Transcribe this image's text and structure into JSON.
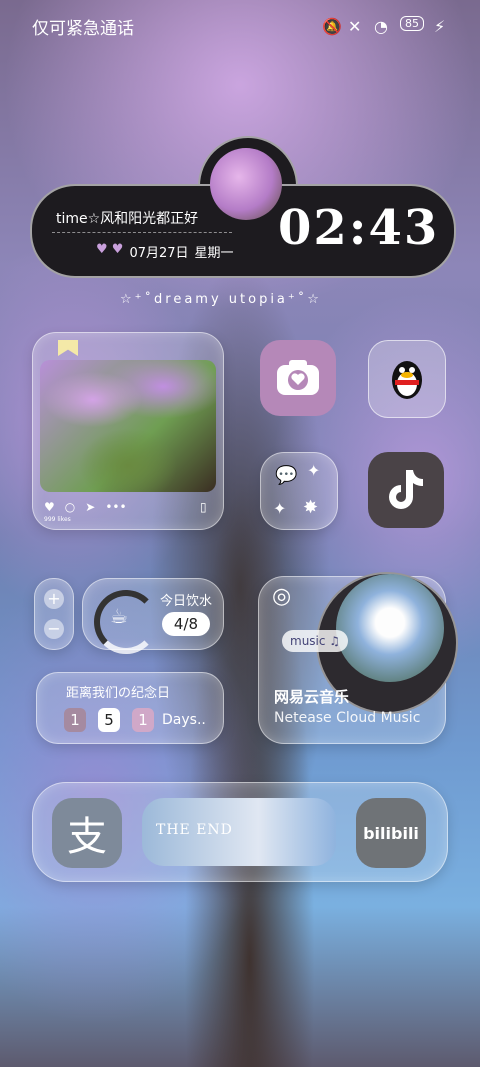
{
  "status_bar": {
    "carrier": "仅可紧急通话",
    "battery": "85"
  },
  "top_widget": {
    "motto": "time☆风和阳光都正好",
    "date": "07月27日",
    "weekday": "星期一",
    "time": "02:43"
  },
  "tagline": "☆⁺˚dreamy utopia⁺˚☆",
  "photo_widget": {
    "likes": "999 likes"
  },
  "apps": {
    "alipay": "支",
    "bilibili": "bilibili"
  },
  "water": {
    "title": "今日饮水",
    "value": "4/8"
  },
  "anniversary": {
    "title": "距离我们の纪念日",
    "digits": [
      "1",
      "5",
      "1"
    ],
    "unit": "Days.."
  },
  "music": {
    "tag": "music",
    "title": "网易云音乐",
    "subtitle": "Netease Cloud Music"
  },
  "banner": {
    "text": "THE END"
  }
}
